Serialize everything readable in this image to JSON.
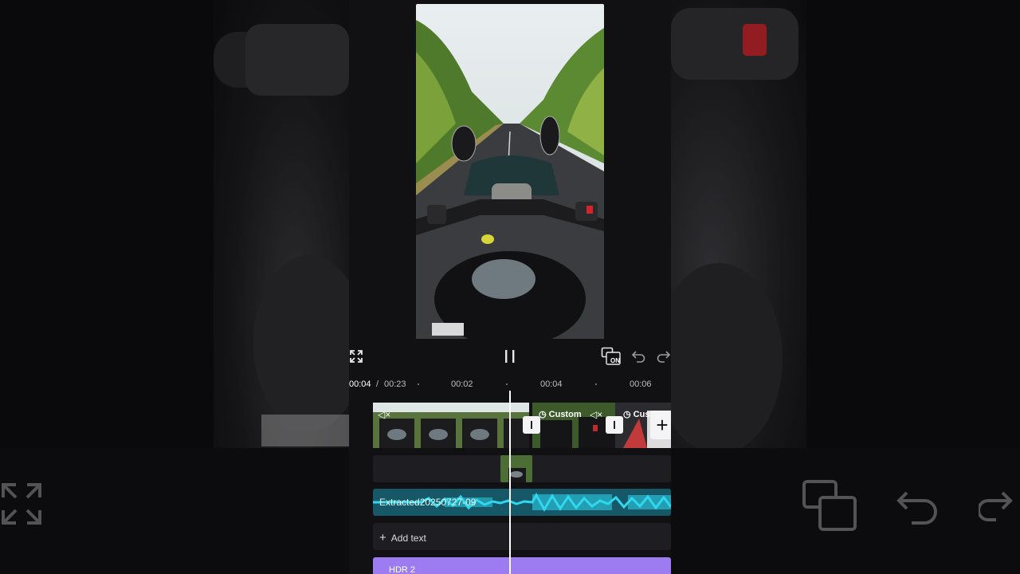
{
  "colors": {
    "accent_audio": "#2fd8ee",
    "effect_track": "#9c7cf0",
    "playhead": "#ffffff",
    "background": "#111114"
  },
  "controls": {
    "fullscreen_icon": "fullscreen-icon",
    "play_pause_icon": "pause-icon",
    "keyframe_badge": "ON",
    "undo_icon": "undo-icon",
    "redo_icon": "redo-icon"
  },
  "timeline": {
    "current_time": "00:04",
    "separator": "/",
    "total_time": "00:23",
    "ticks": [
      "00:02",
      "00:04",
      "00:06"
    ]
  },
  "video_track": {
    "segments": [
      {
        "label": "",
        "muted_icon": "mute-icon"
      },
      {
        "label": "Custom",
        "muted_icon": "mute-icon"
      },
      {
        "label": "Custom",
        "muted_icon": ""
      }
    ],
    "add_clip_icon": "+"
  },
  "audio_track": {
    "label": "Extracted20250727-09"
  },
  "text_track": {
    "add_label": "Add text"
  },
  "effect_track": {
    "label": "HDR 2"
  }
}
